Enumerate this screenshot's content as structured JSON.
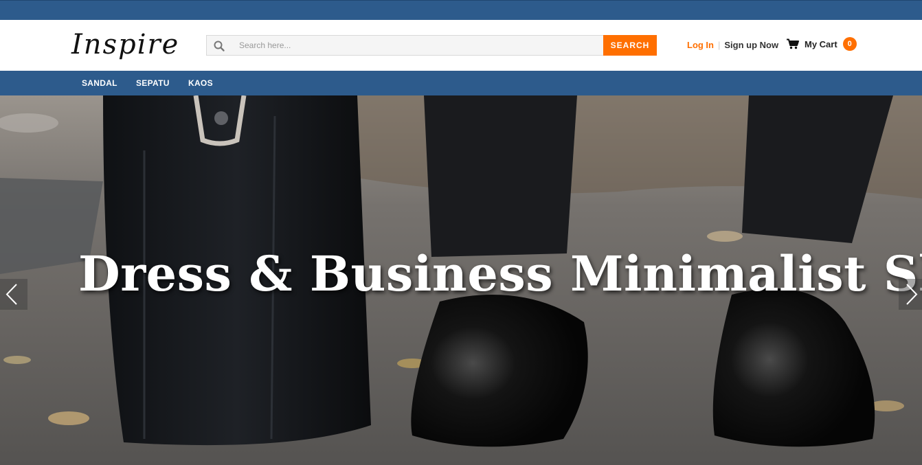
{
  "brand": {
    "logo_text": "Inspire"
  },
  "search": {
    "placeholder": "Search here...",
    "button_label": "SEARCH",
    "icon": "search-icon"
  },
  "auth": {
    "login_label": "Log In",
    "separator": "|",
    "signup_label": "Sign up Now"
  },
  "cart": {
    "label": "My Cart",
    "count": "0",
    "icon": "cart-icon"
  },
  "nav": {
    "items": [
      {
        "label": "SANDAL"
      },
      {
        "label": "SEPATU"
      },
      {
        "label": "KAOS"
      }
    ]
  },
  "hero": {
    "title": "Dress & Business Minimalist Shoes",
    "prev_icon": "chevron-left-icon",
    "next_icon": "chevron-right-icon"
  },
  "colors": {
    "primary": "#2d5b8c",
    "accent": "#ff6f00",
    "text": "#222222"
  }
}
